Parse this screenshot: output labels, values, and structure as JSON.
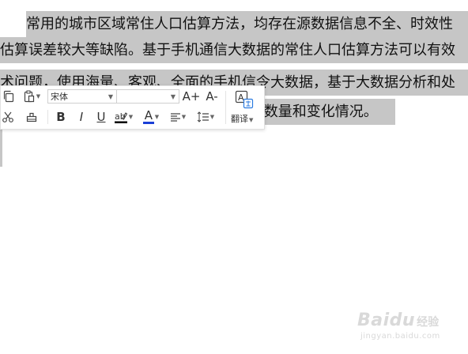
{
  "document": {
    "lines": [
      "常用的城市区域常住人口估算方法，均存在源数据信息不全、时效性",
      "估算误差较大等缺陷。基于手机通信大数据的常住人口估算方法可以有效",
      "术问题，使用海量、客观、全面的手机信令大数据，基于大数据分析和处",
      "l数量和变化情况。"
    ]
  },
  "toolbar": {
    "font_name": "宋体",
    "font_size": "",
    "grow_font_label": "A+",
    "shrink_font_label": "A-",
    "bold_label": "B",
    "italic_label": "I",
    "underline_label": "U",
    "font_color_label": "A",
    "translate_label": "翻译",
    "colors": {
      "font_color_bar": "#1a3fd6",
      "highlight_bar": "#000000"
    }
  },
  "watermark": {
    "logo_text": "Baidu",
    "cn_text": "经验",
    "url_text": "jingyan.baidu.com"
  }
}
